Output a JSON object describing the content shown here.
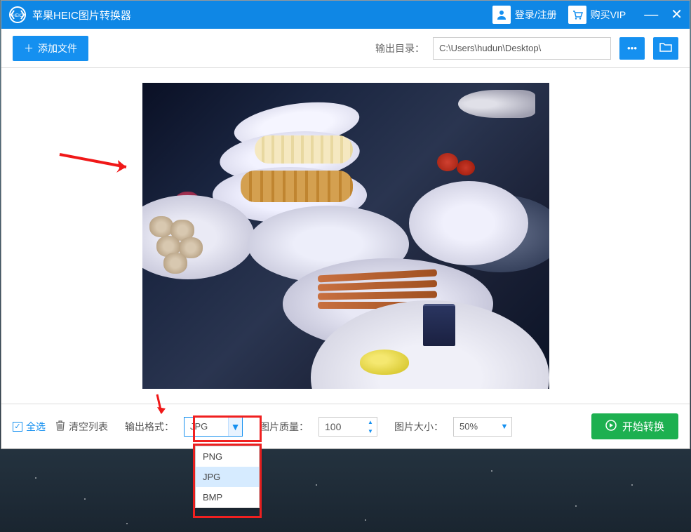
{
  "titlebar": {
    "app_title": "苹果HEIC图片转换器",
    "login_label": "登录/注册",
    "vip_label": "购买VIP"
  },
  "toolbar": {
    "add_file_label": "添加文件",
    "output_dir_label": "输出目录：",
    "output_dir_value": "C:\\Users\\hudun\\Desktop\\"
  },
  "bottombar": {
    "select_all": "全选",
    "clear_list": "清空列表",
    "output_format_label": "输出格式：",
    "output_format_value": "JPG",
    "quality_label": "图片质量：",
    "quality_value": "100",
    "size_label": "图片大小：",
    "size_value": "50%",
    "convert_label": "开始转换"
  },
  "dropdown": {
    "options": [
      "PNG",
      "JPG",
      "BMP"
    ],
    "opt0": "PNG",
    "opt1": "JPG",
    "opt2": "BMP",
    "selected": "JPG"
  }
}
